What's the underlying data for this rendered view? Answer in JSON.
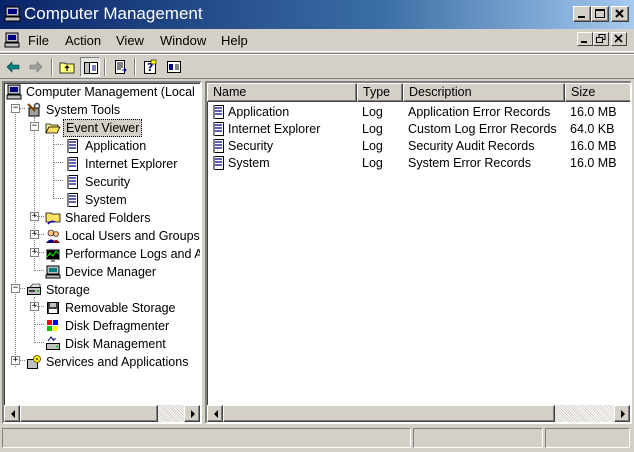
{
  "window": {
    "title": "Computer Management",
    "title_bar_color": "#0a246a"
  },
  "menu": [
    {
      "label": "File"
    },
    {
      "label": "Action"
    },
    {
      "label": "View"
    },
    {
      "label": "Window"
    },
    {
      "label": "Help"
    }
  ],
  "toolbar": {
    "buttons": [
      "back-arrow-icon",
      "forward-arrow-icon",
      "up-folder-icon",
      "show-hide-tree-icon",
      "export-list-icon",
      "help-icon",
      "properties-icon"
    ]
  },
  "tree": {
    "root": "Computer Management (Local",
    "items": [
      {
        "label": "System Tools",
        "icon": "system-tools-icon"
      },
      {
        "label": "Event Viewer",
        "icon": "folder-open-icon"
      },
      {
        "label": "Application",
        "icon": "event-log-icon"
      },
      {
        "label": "Internet Explorer",
        "icon": "event-log-icon"
      },
      {
        "label": "Security",
        "icon": "event-log-icon"
      },
      {
        "label": "System",
        "icon": "event-log-icon"
      },
      {
        "label": "Shared Folders",
        "icon": "shared-folder-icon"
      },
      {
        "label": "Local Users and Groups",
        "icon": "users-icon"
      },
      {
        "label": "Performance Logs and Alerts",
        "icon": "performance-icon"
      },
      {
        "label": "Device Manager",
        "icon": "device-manager-icon"
      },
      {
        "label": "Storage",
        "icon": "storage-icon"
      },
      {
        "label": "Removable Storage",
        "icon": "removable-storage-icon"
      },
      {
        "label": "Disk Defragmenter",
        "icon": "defrag-icon"
      },
      {
        "label": "Disk Management",
        "icon": "disk-management-icon"
      },
      {
        "label": "Services and Applications",
        "icon": "services-icon"
      }
    ]
  },
  "list": {
    "columns": [
      "Name",
      "Type",
      "Description",
      "Size"
    ],
    "rows": [
      {
        "name": "Application",
        "type": "Log",
        "description": "Application Error Records",
        "size": "16.0 MB"
      },
      {
        "name": "Internet Explorer",
        "type": "Log",
        "description": "Custom Log Error Records",
        "size": "64.0 KB"
      },
      {
        "name": "Security",
        "type": "Log",
        "description": "Security Audit Records",
        "size": "16.0 MB"
      },
      {
        "name": "System",
        "type": "Log",
        "description": "System Error Records",
        "size": "16.0 MB"
      }
    ]
  },
  "status": [
    "",
    "",
    ""
  ]
}
